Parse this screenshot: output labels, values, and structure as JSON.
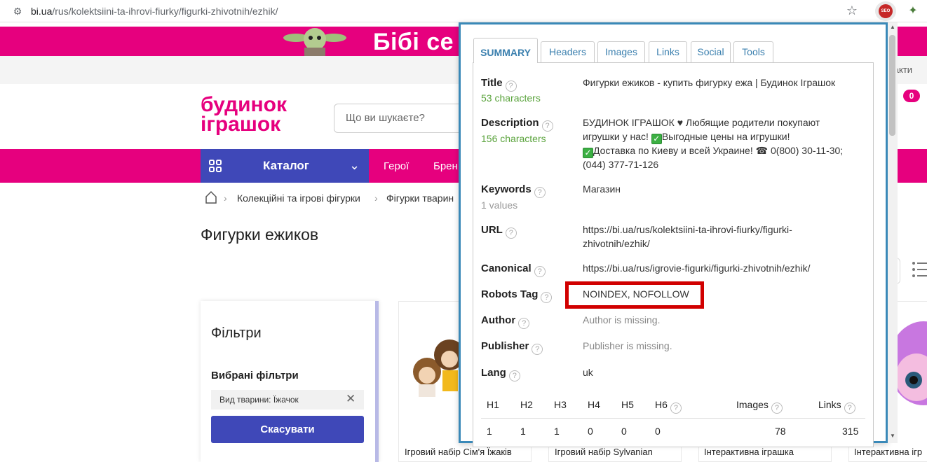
{
  "browser": {
    "url_domain": "bi.ua",
    "url_path": "/rus/kolektsiini-ta-ihrovi-fiurky/figurki-zhivotnih/ezhik/",
    "extension_badge": "SEO"
  },
  "site": {
    "promo_text": "Бібі се",
    "contacts_partial": "ртакти",
    "logo_line1": "будинок",
    "logo_line2": "іграшок",
    "search_placeholder": "Що ви шукаєте?",
    "cart_count": "0",
    "cart_label_partial": "к",
    "catalog_label": "Каталог",
    "nav": [
      "Герої",
      "Брен"
    ],
    "breadcrumb": [
      "Колекційні та ігрові фігурки",
      "Фігурки тварин"
    ],
    "page_title": "Фигурки ежиков",
    "filters": {
      "title": "Фільтри",
      "selected_title": "Вибрані фільтри",
      "chip": "Вид тварини: Їжачок",
      "reset": "Скасувати"
    },
    "products": [
      "Ігровий набір Сім'я Їжаків",
      "Ігровий набір Sylvanian",
      "Інтерактивна іграшка",
      "Інтерактивна ігр"
    ]
  },
  "seo": {
    "tabs": [
      "SUMMARY",
      "Headers",
      "Images",
      "Links",
      "Social",
      "Tools"
    ],
    "title": {
      "label": "Title",
      "count": "53 characters",
      "value": "Фигурки ежиков - купить фигурку ежа | Будинок Іграшок"
    },
    "description": {
      "label": "Description",
      "count": "156 characters",
      "line1": "БУДИНОК ІГРАШОК ♥ Любящие родители покупают",
      "line2": "игрушки у нас! ",
      "line2b": "Выгодные цены на игрушки!",
      "line3b": "Доставка по Киеву и всей Украине! ☎ 0(800) 30-11-30;",
      "line4": "(044) 377-71-126"
    },
    "keywords": {
      "label": "Keywords",
      "count": "1 values",
      "value": "Магазин"
    },
    "url": {
      "label": "URL",
      "line1": "https://bi.ua/rus/kolektsiini-ta-ihrovi-fiurky/figurki-",
      "line2": "zhivotnih/ezhik/"
    },
    "canonical": {
      "label": "Canonical",
      "value": "https://bi.ua/rus/igrovie-figurki/figurki-zhivotnih/ezhik/"
    },
    "robots": {
      "label": "Robots Tag",
      "value": "NOINDEX, NOFOLLOW"
    },
    "author": {
      "label": "Author",
      "value": "Author is missing."
    },
    "publisher": {
      "label": "Publisher",
      "value": "Publisher is missing."
    },
    "lang": {
      "label": "Lang",
      "value": "uk"
    },
    "headings": {
      "labels": [
        "H1",
        "H2",
        "H3",
        "H4",
        "H5",
        "H6",
        "Images",
        "Links"
      ],
      "values": [
        "1",
        "1",
        "1",
        "0",
        "0",
        "0",
        "78",
        "315"
      ]
    },
    "help_glyph": "?"
  }
}
